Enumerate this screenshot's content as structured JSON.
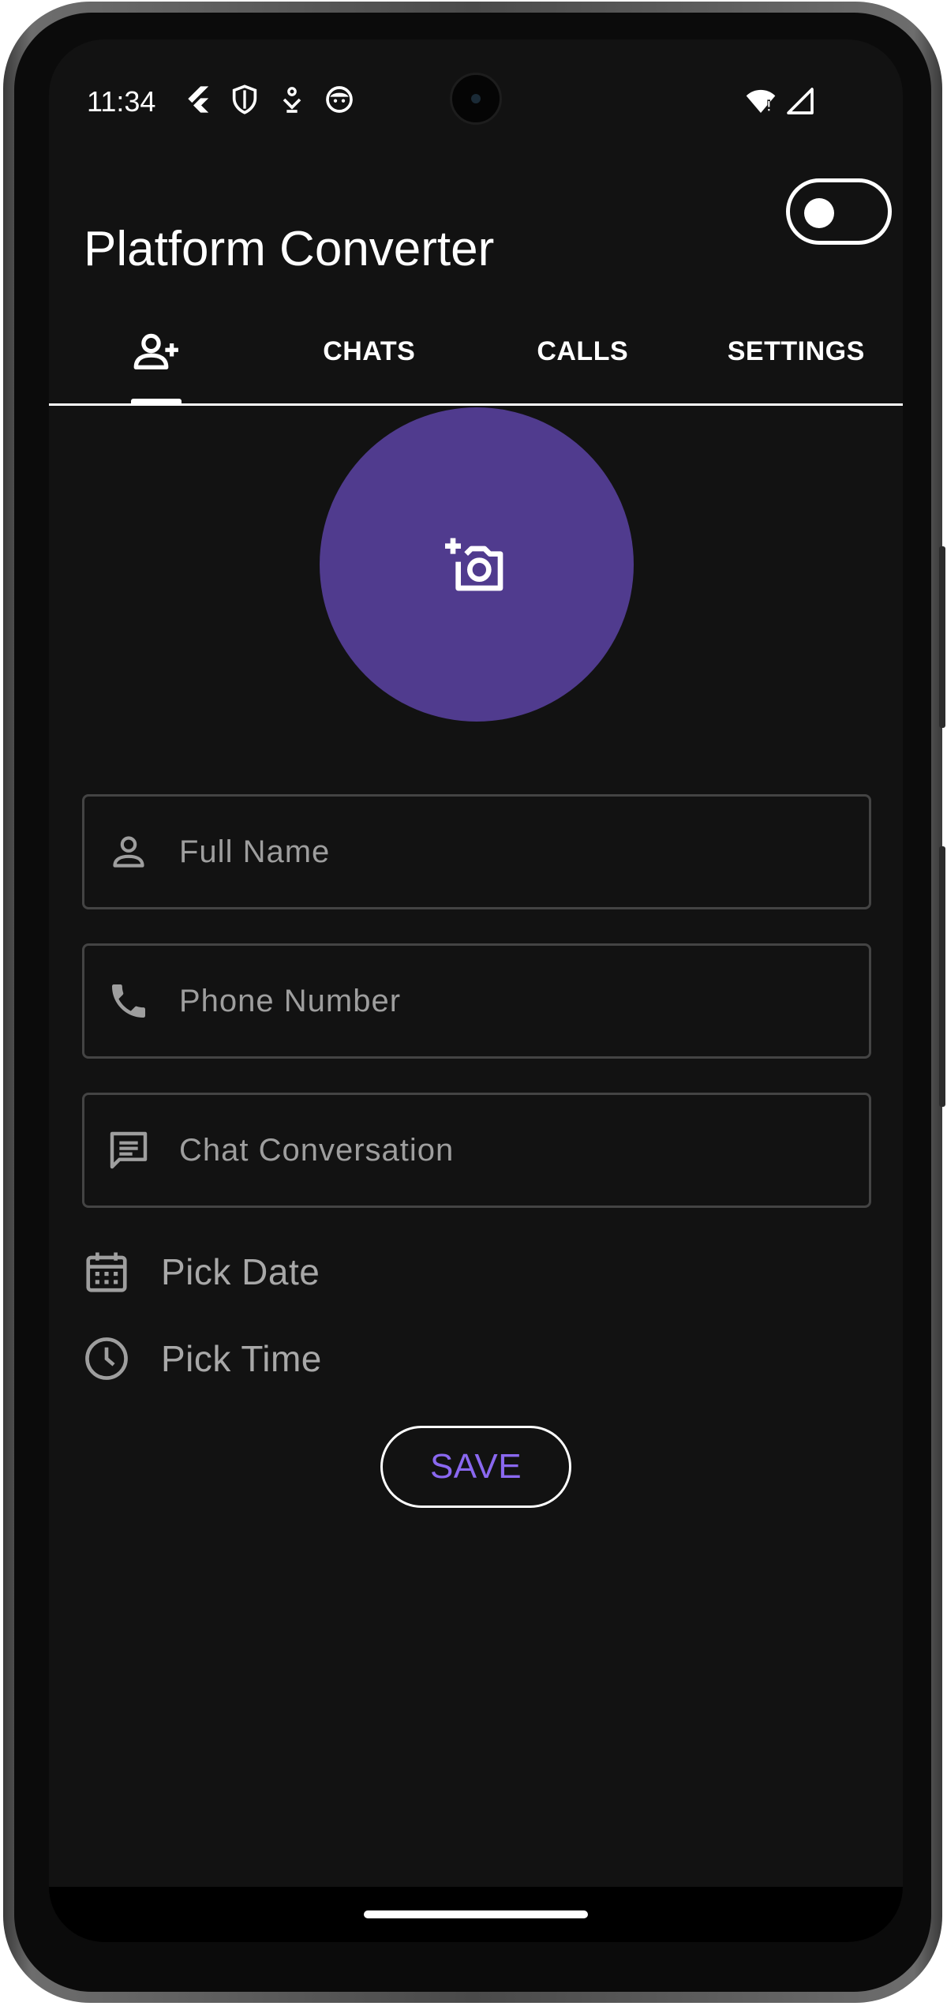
{
  "status_bar": {
    "time": "11:34",
    "left_icons": [
      "flutter-icon",
      "shield-icon",
      "download-icon",
      "face-icon"
    ],
    "right_icons": [
      "wifi-icon",
      "cell-signal-icon"
    ]
  },
  "app_bar": {
    "title": "Platform Converter",
    "theme_toggle": "off"
  },
  "tabs": [
    {
      "label": "",
      "icon": "add-contact-icon",
      "selected": true
    },
    {
      "label": "CHATS",
      "selected": false
    },
    {
      "label": "CALLS",
      "selected": false
    },
    {
      "label": "SETTINGS",
      "selected": false
    }
  ],
  "avatar": {
    "icon": "add-photo-icon",
    "color": "#503b8e"
  },
  "form": {
    "full_name_placeholder": "Full Name",
    "phone_placeholder": "Phone Number",
    "chat_placeholder": "Chat Conversation",
    "pick_date_label": "Pick Date",
    "pick_time_label": "Pick Time",
    "save_label": "SAVE"
  },
  "colors": {
    "background": "#121212",
    "accent": "#8a68f0",
    "avatar": "#503b8e"
  }
}
